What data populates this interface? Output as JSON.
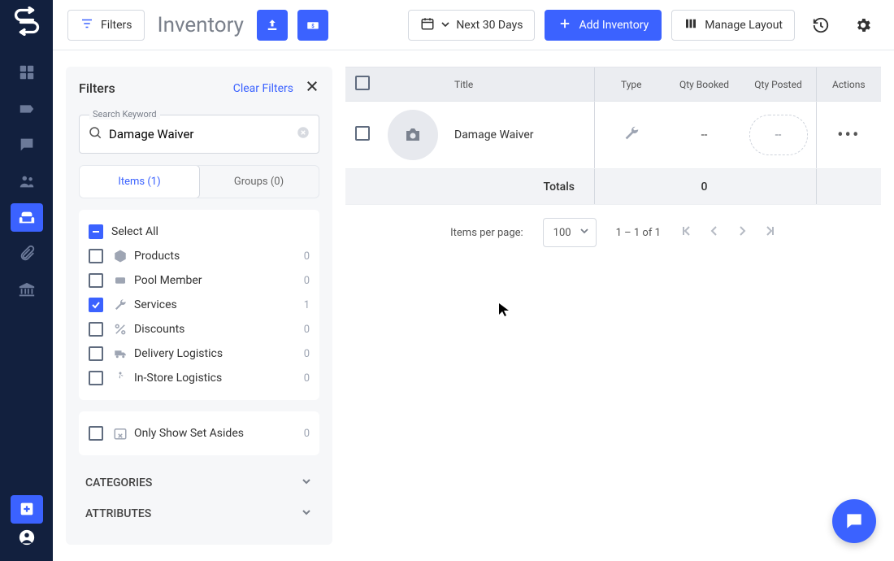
{
  "topbar": {
    "filters_btn": "Filters",
    "title": "Inventory",
    "date_range": "Next 30 Days",
    "add_btn": "Add Inventory",
    "manage_btn": "Manage Layout"
  },
  "filters_panel": {
    "title": "Filters",
    "clear": "Clear Filters",
    "search_label": "Search Keyword",
    "search_value": "Damage Waiver",
    "tabs": {
      "items": "Items (1)",
      "groups": "Groups (0)"
    },
    "select_all": "Select All",
    "types": [
      {
        "label": "Products",
        "count": "0",
        "checked": false
      },
      {
        "label": "Pool Member",
        "count": "0",
        "checked": false
      },
      {
        "label": "Services",
        "count": "1",
        "checked": true
      },
      {
        "label": "Discounts",
        "count": "0",
        "checked": false
      },
      {
        "label": "Delivery Logistics",
        "count": "0",
        "checked": false
      },
      {
        "label": "In-Store Logistics",
        "count": "0",
        "checked": false
      }
    ],
    "set_asides": {
      "label": "Only Show Set Asides",
      "count": "0"
    },
    "sections": {
      "categories": "CATEGORIES",
      "attributes": "ATTRIBUTES"
    }
  },
  "table": {
    "cols": {
      "title": "Title",
      "type": "Type",
      "qty_booked": "Qty Booked",
      "qty_posted": "Qty Posted",
      "actions": "Actions"
    },
    "row": {
      "title": "Damage Waiver",
      "qty_booked": "--",
      "qty_posted": "--"
    },
    "totals_label": "Totals",
    "totals_value": "0"
  },
  "paginator": {
    "ipp_label": "Items per page:",
    "page_size": "100",
    "range": "1 – 1 of 1"
  }
}
